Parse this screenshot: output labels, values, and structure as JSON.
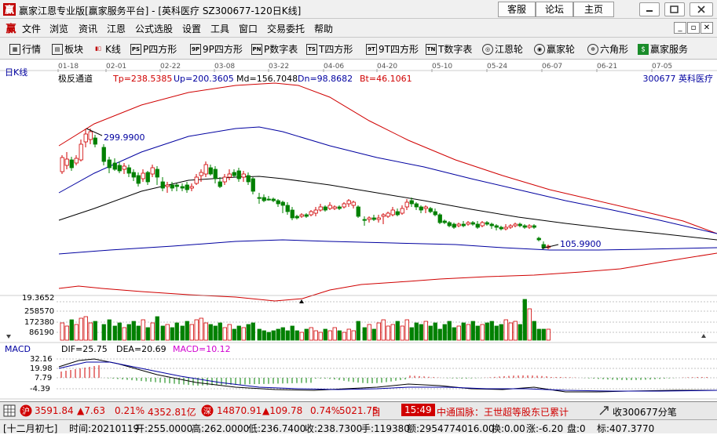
{
  "window": {
    "title": "赢家江恩专业版[赢家服务平台] - [英科医疗   SZ300677-120日K线]",
    "btn_service": "客服",
    "btn_forum": "论坛",
    "btn_home": "主页"
  },
  "menu": [
    "文件",
    "浏览",
    "资讯",
    "江恩",
    "公式选股",
    "设置",
    "工具",
    "窗口",
    "交易委托",
    "帮助"
  ],
  "toolbar": [
    "行情",
    "板块",
    "K线",
    "P四方形",
    "9P四方形",
    "P数字表",
    "T四方形",
    "9T四方形",
    "T数字表",
    "江恩轮",
    "赢家轮",
    "六角形",
    "赢家服务"
  ],
  "toolbar_icons": [
    "grid-icon",
    "blocks-icon",
    "kline-icon",
    "p-square-icon",
    "9p-square-icon",
    "p-number-icon",
    "t-square-icon",
    "9t-square-icon",
    "t-number-icon",
    "gann-wheel-icon",
    "winner-wheel-icon",
    "hexagon-icon",
    "service-icon"
  ],
  "chart": {
    "panel_label": "日K线",
    "indicator": "极反通道",
    "tp": "Tp=238.5385",
    "up": "Up=200.3605",
    "md": "Md=156.7048",
    "dn": "Dn=98.8682",
    "bt": "Bt=46.1061",
    "stock": "300677  英科医疗",
    "dates": [
      "01-18",
      "02-01",
      "02-22",
      "03-08",
      "03-22",
      "04-06",
      "04-20",
      "05-10",
      "05-24",
      "06-07",
      "06-21",
      "07-05"
    ],
    "high_label": "299.9900",
    "low_label": "105.9900",
    "vol_axis": [
      "19.3652",
      "258570",
      "172380",
      "86190"
    ],
    "macd": {
      "name": "MACD",
      "dif": "DIF=25.75",
      "dea": "DEA=20.69",
      "macd": "MACD=10.12",
      "axis": [
        "32.16",
        "19.98",
        "7.79",
        "-4.39"
      ]
    },
    "colors": {
      "up": "#d00000",
      "down": "#008000",
      "upper": "#d00000",
      "mid": "#0000a0",
      "center": "#000000"
    }
  },
  "status1": {
    "idx1": "3591.84",
    "idx1_chg": "▲7.63",
    "idx1_pct": "0.21%",
    "idx1_amt": "4352.81亿",
    "idx2": "14870.91",
    "idx2_chg": "▲109.78",
    "idx2_pct": "0.74%",
    "idx2_amt": "5021.75",
    "tag": "目",
    "time": "15:49",
    "news": "中通国脉：王世超等股东已累计",
    "collect": "收300677分笔"
  },
  "status2": {
    "lunar": "[十二月初七]",
    "time": "时间:20210119",
    "open": "开:255.0000",
    "high": "高:262.0000",
    "low": "低:236.7400",
    "close": "收:238.7300",
    "hand": "手:119380",
    "amount": "额:2954774016.00",
    "turnover": "换:0.00",
    "change": "涨:-6.20",
    "pan": "盘:0",
    "mark": "标:407.3770"
  }
}
